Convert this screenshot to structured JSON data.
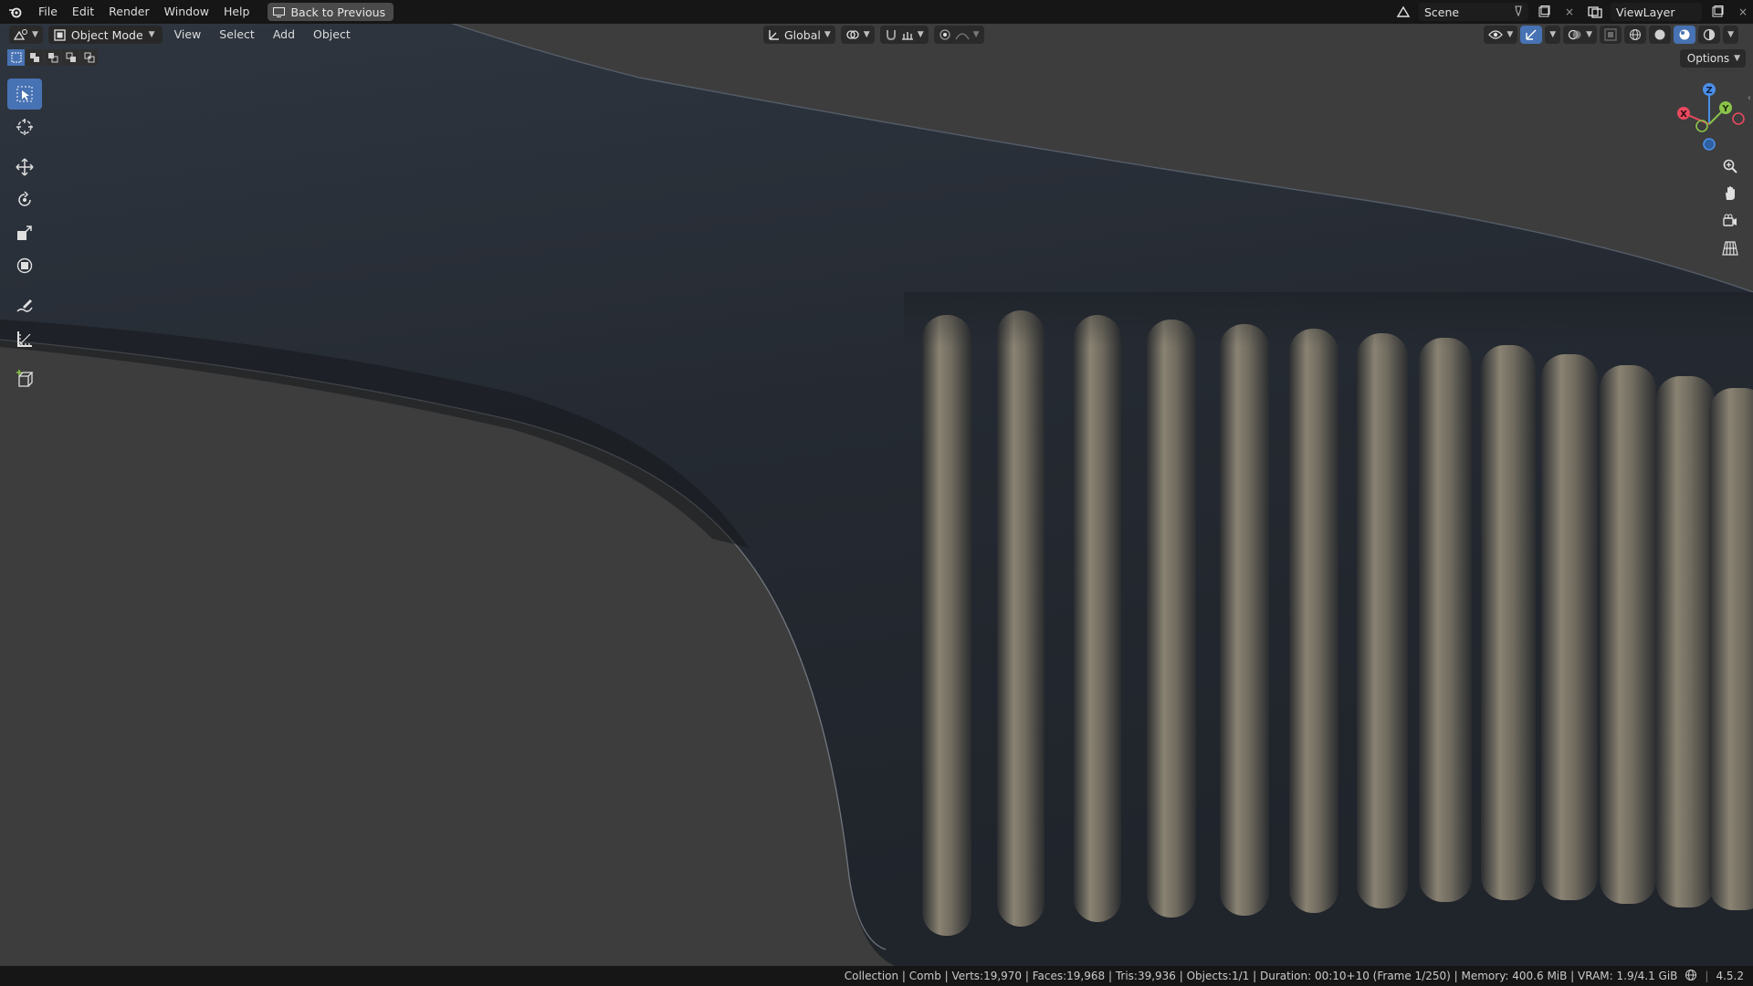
{
  "topbar": {
    "menu": [
      "File",
      "Edit",
      "Render",
      "Window",
      "Help"
    ],
    "back_button": "Back to Previous",
    "scene_label": "Scene",
    "viewlayer_label": "ViewLayer"
  },
  "header": {
    "mode_label": "Object Mode",
    "menu": [
      "View",
      "Select",
      "Add",
      "Object"
    ],
    "transform_orientation": "Global",
    "options_label": "Options"
  },
  "toolbar": {
    "tools": [
      "select-box",
      "cursor",
      "move",
      "rotate",
      "scale",
      "transform",
      "annotate",
      "measure",
      "add-cube"
    ],
    "active_tool": "select-box"
  },
  "gizmo": {
    "axes": [
      "X",
      "Y",
      "Z"
    ],
    "colors": {
      "x": "#e84a5f",
      "y": "#8bc34a",
      "z": "#4a8fe8"
    }
  },
  "status": {
    "text": "Collection | Comb | Verts:19,970 | Faces:19,968 | Tris:39,936 | Objects:1/1 | Duration: 00:10+10 (Frame 1/250) | Memory: 400.6 MiB | VRAM: 1.9/4.1 GiB",
    "version": "4.5.2"
  },
  "colors": {
    "accent": "#4772b3",
    "background": "#3d3d3d",
    "comb_body": "#262a33"
  }
}
